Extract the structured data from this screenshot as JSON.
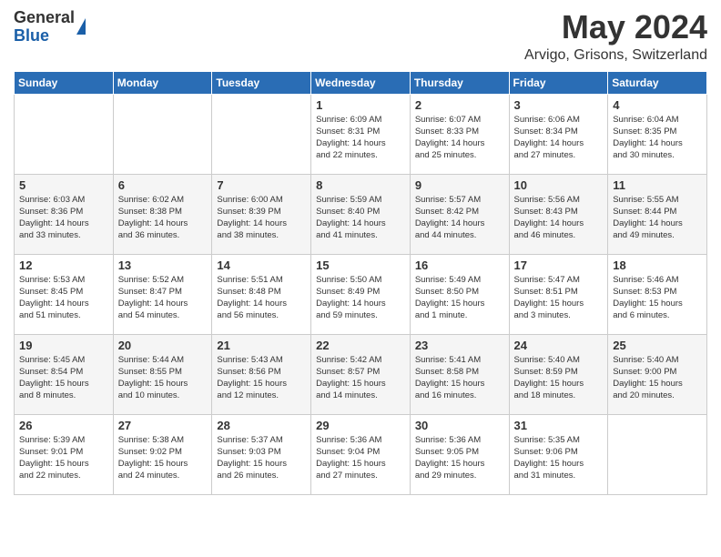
{
  "logo": {
    "general": "General",
    "blue": "Blue"
  },
  "header": {
    "month_year": "May 2024",
    "location": "Arvigo, Grisons, Switzerland"
  },
  "weekdays": [
    "Sunday",
    "Monday",
    "Tuesday",
    "Wednesday",
    "Thursday",
    "Friday",
    "Saturday"
  ],
  "weeks": [
    [
      {
        "day": "",
        "info": ""
      },
      {
        "day": "",
        "info": ""
      },
      {
        "day": "",
        "info": ""
      },
      {
        "day": "1",
        "info": "Sunrise: 6:09 AM\nSunset: 8:31 PM\nDaylight: 14 hours\nand 22 minutes."
      },
      {
        "day": "2",
        "info": "Sunrise: 6:07 AM\nSunset: 8:33 PM\nDaylight: 14 hours\nand 25 minutes."
      },
      {
        "day": "3",
        "info": "Sunrise: 6:06 AM\nSunset: 8:34 PM\nDaylight: 14 hours\nand 27 minutes."
      },
      {
        "day": "4",
        "info": "Sunrise: 6:04 AM\nSunset: 8:35 PM\nDaylight: 14 hours\nand 30 minutes."
      }
    ],
    [
      {
        "day": "5",
        "info": "Sunrise: 6:03 AM\nSunset: 8:36 PM\nDaylight: 14 hours\nand 33 minutes."
      },
      {
        "day": "6",
        "info": "Sunrise: 6:02 AM\nSunset: 8:38 PM\nDaylight: 14 hours\nand 36 minutes."
      },
      {
        "day": "7",
        "info": "Sunrise: 6:00 AM\nSunset: 8:39 PM\nDaylight: 14 hours\nand 38 minutes."
      },
      {
        "day": "8",
        "info": "Sunrise: 5:59 AM\nSunset: 8:40 PM\nDaylight: 14 hours\nand 41 minutes."
      },
      {
        "day": "9",
        "info": "Sunrise: 5:57 AM\nSunset: 8:42 PM\nDaylight: 14 hours\nand 44 minutes."
      },
      {
        "day": "10",
        "info": "Sunrise: 5:56 AM\nSunset: 8:43 PM\nDaylight: 14 hours\nand 46 minutes."
      },
      {
        "day": "11",
        "info": "Sunrise: 5:55 AM\nSunset: 8:44 PM\nDaylight: 14 hours\nand 49 minutes."
      }
    ],
    [
      {
        "day": "12",
        "info": "Sunrise: 5:53 AM\nSunset: 8:45 PM\nDaylight: 14 hours\nand 51 minutes."
      },
      {
        "day": "13",
        "info": "Sunrise: 5:52 AM\nSunset: 8:47 PM\nDaylight: 14 hours\nand 54 minutes."
      },
      {
        "day": "14",
        "info": "Sunrise: 5:51 AM\nSunset: 8:48 PM\nDaylight: 14 hours\nand 56 minutes."
      },
      {
        "day": "15",
        "info": "Sunrise: 5:50 AM\nSunset: 8:49 PM\nDaylight: 14 hours\nand 59 minutes."
      },
      {
        "day": "16",
        "info": "Sunrise: 5:49 AM\nSunset: 8:50 PM\nDaylight: 15 hours\nand 1 minute."
      },
      {
        "day": "17",
        "info": "Sunrise: 5:47 AM\nSunset: 8:51 PM\nDaylight: 15 hours\nand 3 minutes."
      },
      {
        "day": "18",
        "info": "Sunrise: 5:46 AM\nSunset: 8:53 PM\nDaylight: 15 hours\nand 6 minutes."
      }
    ],
    [
      {
        "day": "19",
        "info": "Sunrise: 5:45 AM\nSunset: 8:54 PM\nDaylight: 15 hours\nand 8 minutes."
      },
      {
        "day": "20",
        "info": "Sunrise: 5:44 AM\nSunset: 8:55 PM\nDaylight: 15 hours\nand 10 minutes."
      },
      {
        "day": "21",
        "info": "Sunrise: 5:43 AM\nSunset: 8:56 PM\nDaylight: 15 hours\nand 12 minutes."
      },
      {
        "day": "22",
        "info": "Sunrise: 5:42 AM\nSunset: 8:57 PM\nDaylight: 15 hours\nand 14 minutes."
      },
      {
        "day": "23",
        "info": "Sunrise: 5:41 AM\nSunset: 8:58 PM\nDaylight: 15 hours\nand 16 minutes."
      },
      {
        "day": "24",
        "info": "Sunrise: 5:40 AM\nSunset: 8:59 PM\nDaylight: 15 hours\nand 18 minutes."
      },
      {
        "day": "25",
        "info": "Sunrise: 5:40 AM\nSunset: 9:00 PM\nDaylight: 15 hours\nand 20 minutes."
      }
    ],
    [
      {
        "day": "26",
        "info": "Sunrise: 5:39 AM\nSunset: 9:01 PM\nDaylight: 15 hours\nand 22 minutes."
      },
      {
        "day": "27",
        "info": "Sunrise: 5:38 AM\nSunset: 9:02 PM\nDaylight: 15 hours\nand 24 minutes."
      },
      {
        "day": "28",
        "info": "Sunrise: 5:37 AM\nSunset: 9:03 PM\nDaylight: 15 hours\nand 26 minutes."
      },
      {
        "day": "29",
        "info": "Sunrise: 5:36 AM\nSunset: 9:04 PM\nDaylight: 15 hours\nand 27 minutes."
      },
      {
        "day": "30",
        "info": "Sunrise: 5:36 AM\nSunset: 9:05 PM\nDaylight: 15 hours\nand 29 minutes."
      },
      {
        "day": "31",
        "info": "Sunrise: 5:35 AM\nSunset: 9:06 PM\nDaylight: 15 hours\nand 31 minutes."
      },
      {
        "day": "",
        "info": ""
      }
    ]
  ]
}
